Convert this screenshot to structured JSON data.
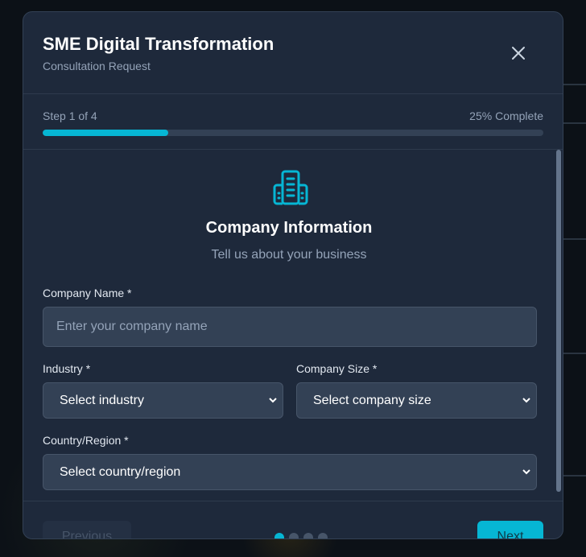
{
  "modal": {
    "title": "SME Digital Transformation",
    "subtitle": "Consultation Request"
  },
  "progress": {
    "step_label": "Step 1 of 4",
    "percent_label": "25% Complete",
    "fraction": 0.25,
    "current_step": 1,
    "total_steps": 4
  },
  "section": {
    "icon": "building-icon",
    "title": "Company Information",
    "subtitle": "Tell us about your business"
  },
  "form": {
    "company_name": {
      "label": "Company Name *",
      "placeholder": "Enter your company name",
      "value": ""
    },
    "industry": {
      "label": "Industry *",
      "selected": "Select industry"
    },
    "company_size": {
      "label": "Company Size *",
      "selected": "Select company size"
    },
    "country": {
      "label": "Country/Region *",
      "selected": "Select country/region"
    }
  },
  "footer": {
    "previous_label": "Previous",
    "next_label": "Next"
  },
  "colors": {
    "accent": "#06b6d4",
    "panel": "#1e293b",
    "input": "#334155"
  }
}
